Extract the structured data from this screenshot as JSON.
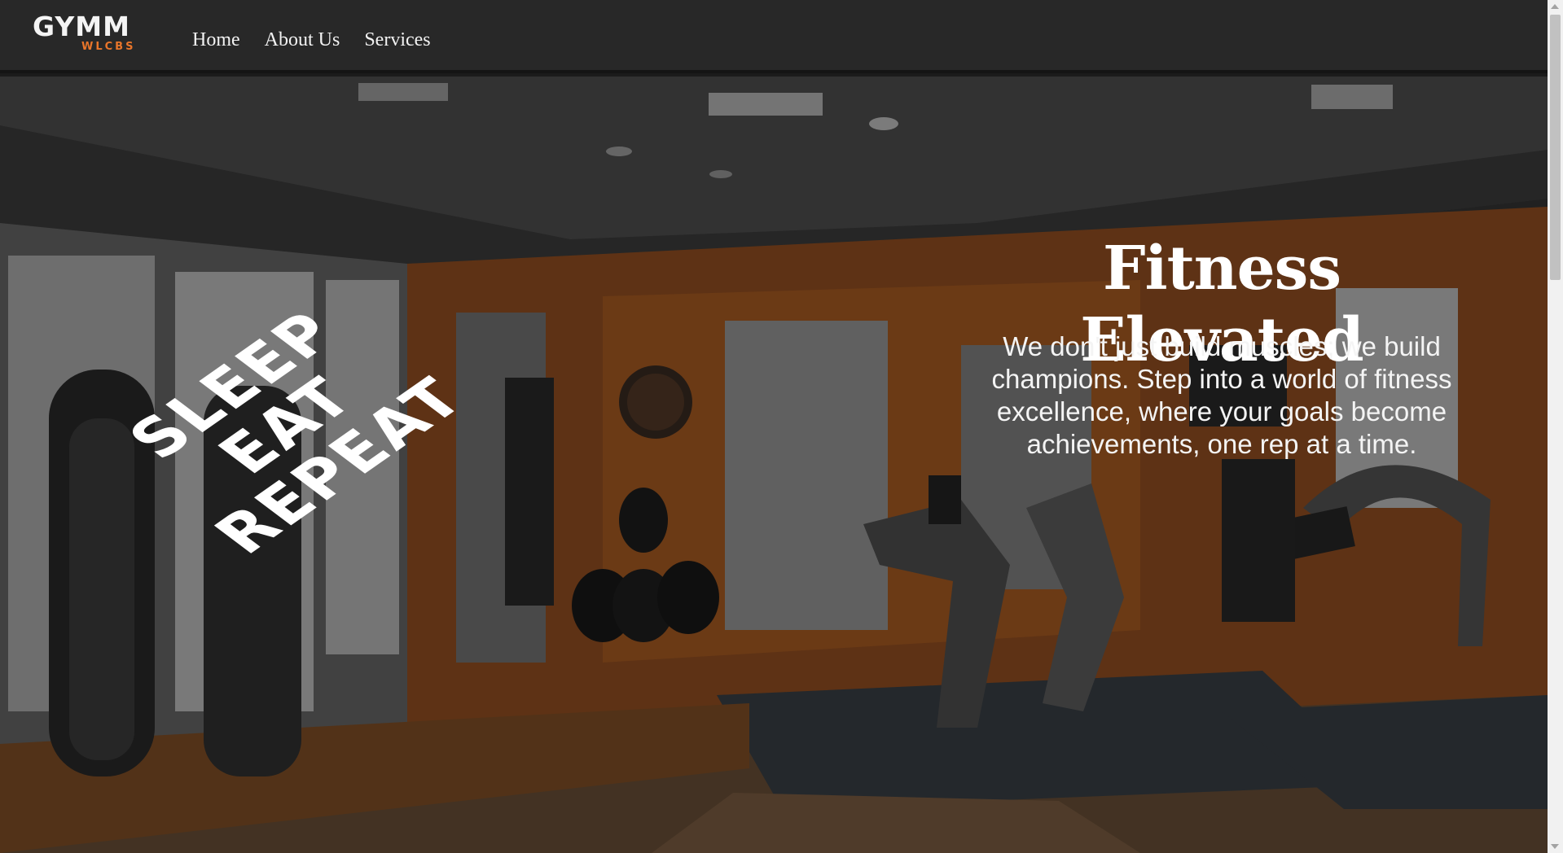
{
  "brand": {
    "name": "GYMM",
    "tagline": "WLCBS",
    "accent_color": "#e8752a"
  },
  "nav": {
    "items": [
      {
        "label": "Home"
      },
      {
        "label": "About Us"
      },
      {
        "label": "Services"
      }
    ]
  },
  "hero": {
    "slogan": [
      "SLEEP",
      "EAT",
      "REPEAT"
    ],
    "title": "Fitness Elevated",
    "description": "We don't just build muscles; we build champions. Step into a world of fitness excellence, where your goals become achievements, one rep at a time.",
    "background_icon": "gym-interior-image"
  }
}
